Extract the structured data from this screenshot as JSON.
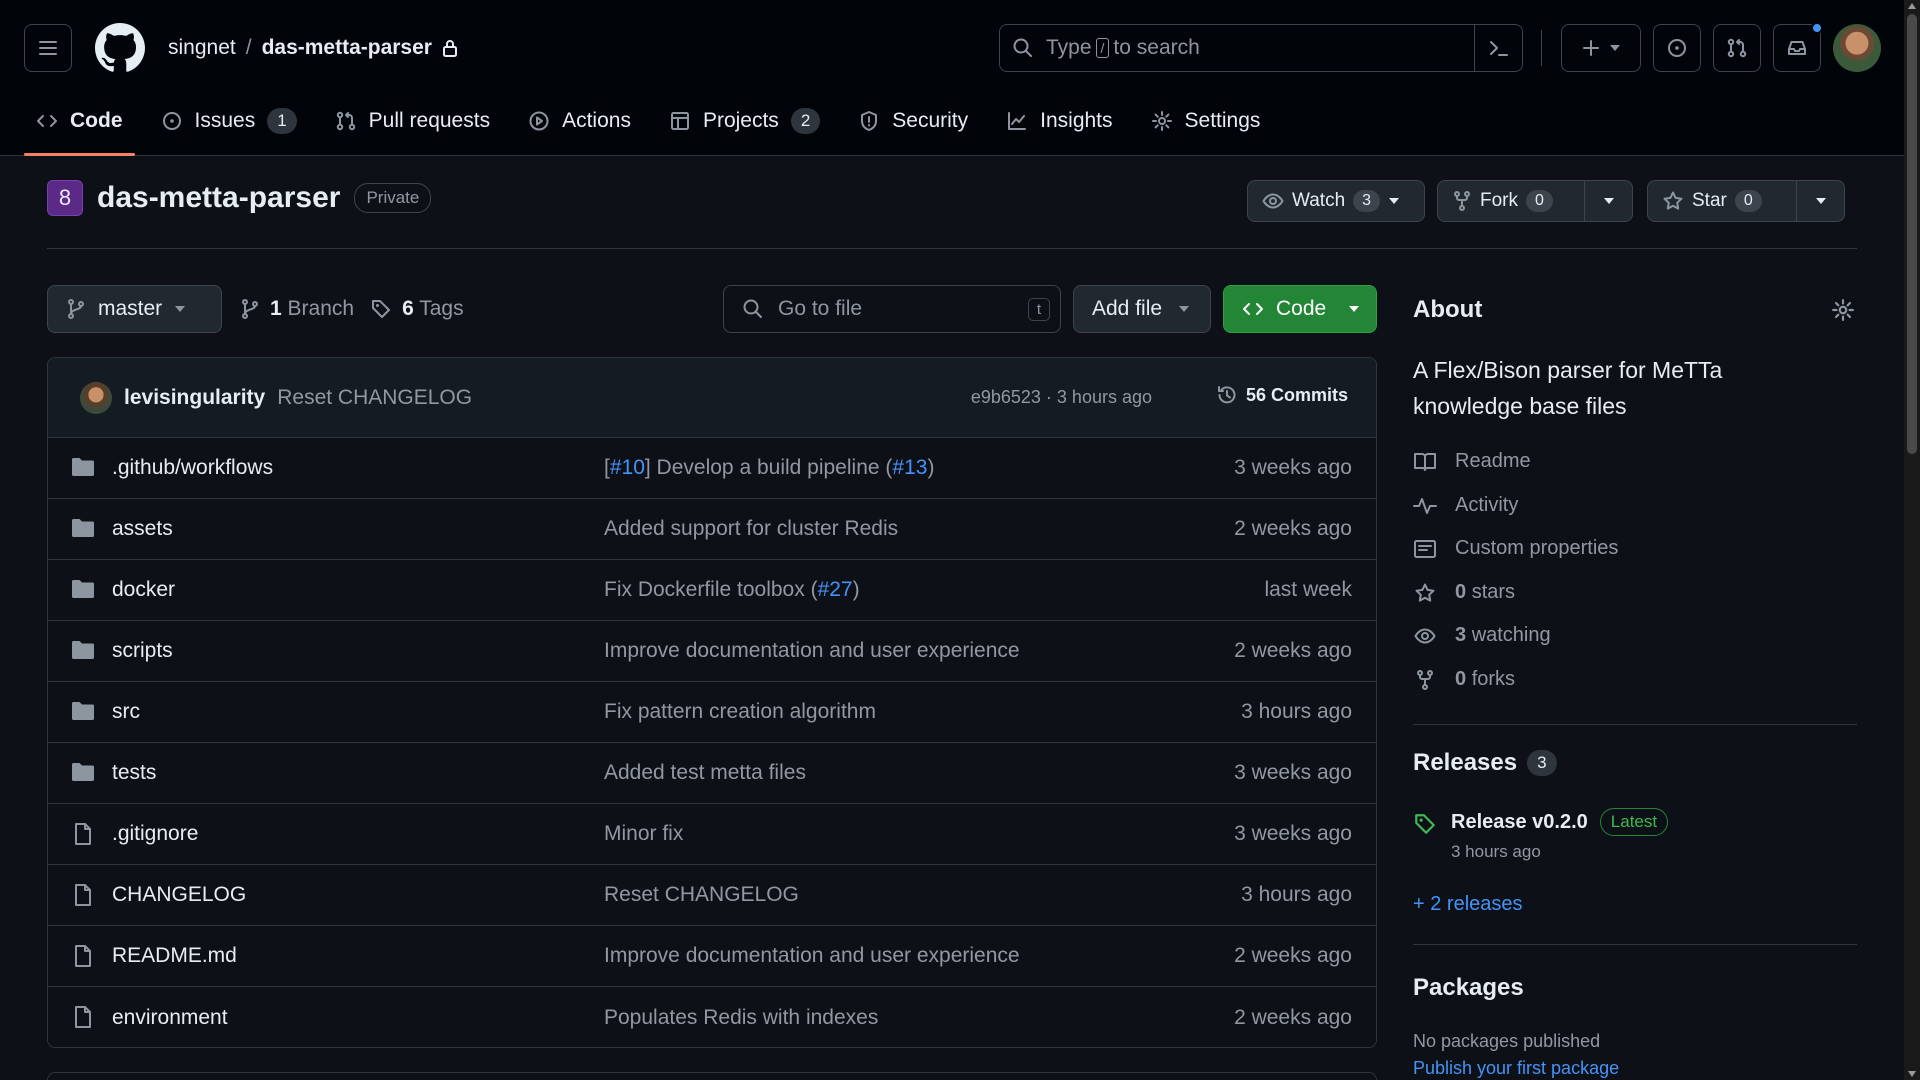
{
  "header": {
    "owner": "singnet",
    "separator": "/",
    "repo": "das-metta-parser",
    "search": {
      "prefix": "Type",
      "key": "/",
      "suffix": "to search"
    }
  },
  "tabs": [
    {
      "label": "Code",
      "icon": "code-icon",
      "active": true
    },
    {
      "label": "Issues",
      "icon": "issue-icon",
      "count": "1"
    },
    {
      "label": "Pull requests",
      "icon": "pull-request-icon"
    },
    {
      "label": "Actions",
      "icon": "play-icon"
    },
    {
      "label": "Projects",
      "icon": "table-icon",
      "count": "2"
    },
    {
      "label": "Security",
      "icon": "shield-icon"
    },
    {
      "label": "Insights",
      "icon": "graph-icon"
    },
    {
      "label": "Settings",
      "icon": "gear-icon"
    }
  ],
  "repo_header": {
    "name": "das-metta-parser",
    "avatar_glyph": "8",
    "visibility": "Private",
    "watch": {
      "label": "Watch",
      "count": "3"
    },
    "fork": {
      "label": "Fork",
      "count": "0"
    },
    "star": {
      "label": "Star",
      "count": "0"
    }
  },
  "toolbar": {
    "branch": "master",
    "branches_count": "1",
    "branches_label": "Branch",
    "tags_count": "6",
    "tags_label": "Tags",
    "goto_placeholder": "Go to file",
    "goto_key": "t",
    "add_file": "Add file",
    "code": "Code"
  },
  "latest_commit": {
    "author": "levisingularity",
    "message": "Reset CHANGELOG",
    "hash": "e9b6523",
    "dot": "·",
    "time": "3 hours ago",
    "commits_label": "56 Commits"
  },
  "files": [
    {
      "name": ".github/workflows",
      "type": "dir",
      "msg_parts": [
        "[",
        "#10",
        "] Develop a build pipeline (",
        "#13",
        ")"
      ],
      "time": "3 weeks ago"
    },
    {
      "name": "assets",
      "type": "dir",
      "msg": "Added support for cluster Redis",
      "time": "2 weeks ago"
    },
    {
      "name": "docker",
      "type": "dir",
      "msg_parts": [
        "Fix Dockerfile toolbox (",
        "#27",
        ")"
      ],
      "time": "last week"
    },
    {
      "name": "scripts",
      "type": "dir",
      "msg": "Improve documentation and user experience",
      "time": "2 weeks ago"
    },
    {
      "name": "src",
      "type": "dir",
      "msg": "Fix pattern creation algorithm",
      "time": "3 hours ago"
    },
    {
      "name": "tests",
      "type": "dir",
      "msg": "Added test metta files",
      "time": "3 weeks ago"
    },
    {
      "name": ".gitignore",
      "type": "file",
      "msg": "Minor fix",
      "time": "3 weeks ago"
    },
    {
      "name": "CHANGELOG",
      "type": "file",
      "msg": "Reset CHANGELOG",
      "time": "3 hours ago"
    },
    {
      "name": "README.md",
      "type": "file",
      "msg": "Improve documentation and user experience",
      "time": "2 weeks ago"
    },
    {
      "name": "environment",
      "type": "file",
      "msg": "Populates Redis with indexes",
      "time": "2 weeks ago"
    }
  ],
  "about": {
    "title": "About",
    "description": "A Flex/Bison parser for MeTTa knowledge base files",
    "readme": "Readme",
    "activity": "Activity",
    "custom_properties": "Custom properties",
    "stars_count": "0",
    "stars_label": "stars",
    "watching_count": "3",
    "watching_label": "watching",
    "forks_count": "0",
    "forks_label": "forks"
  },
  "releases": {
    "title": "Releases",
    "count": "3",
    "latest_name": "Release v0.2.0",
    "latest_badge": "Latest",
    "latest_time": "3 hours ago",
    "more": "+ 2 releases"
  },
  "packages": {
    "title": "Packages",
    "empty": "No packages published",
    "publish_link": "Publish your first package"
  },
  "colors": {
    "background": "#0d1117",
    "header_bg": "#010409",
    "link": "#4493f8",
    "primary_button": "#238636",
    "active_tab_underline": "#f78166",
    "latest_badge": "#3fb950"
  }
}
